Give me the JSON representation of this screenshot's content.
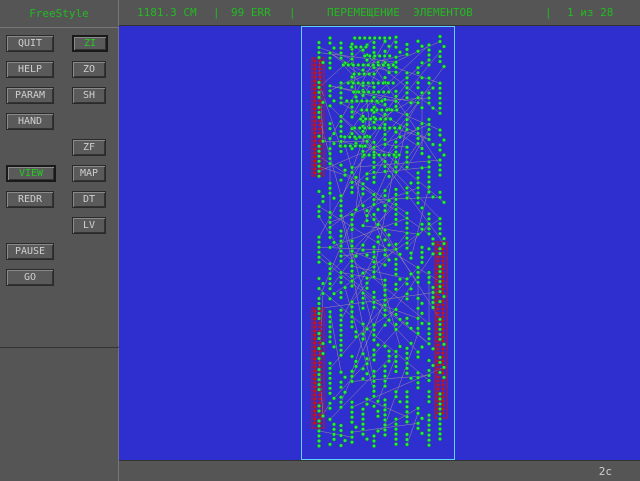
{
  "app": {
    "title": "FreeStyle"
  },
  "status": {
    "length": "1181.3 CM",
    "errors": "99 ERR",
    "mode": "ПЕРЕМЕЩЕНИЕ  ЭЛЕМЕНТОВ",
    "pass": "1 из 28"
  },
  "buttons": {
    "quit": "QUIT",
    "help": "HELP",
    "param": "PARAM",
    "hand": "HAND",
    "view": "VIEW",
    "redr": "REDR",
    "pause": "PAUSE",
    "go": "GO",
    "zi": "ZI",
    "zo": "ZO",
    "sh": "SH",
    "zf": "ZF",
    "map": "MAP",
    "dt": "DT",
    "lv": "LV"
  },
  "footer": {
    "time": "2c"
  },
  "colors": {
    "canvas": "#2f2fd0",
    "board_outline": "#5fd0ff",
    "pad": "#22ee44",
    "connector": "#cc1111",
    "rats": "#a090a0"
  }
}
